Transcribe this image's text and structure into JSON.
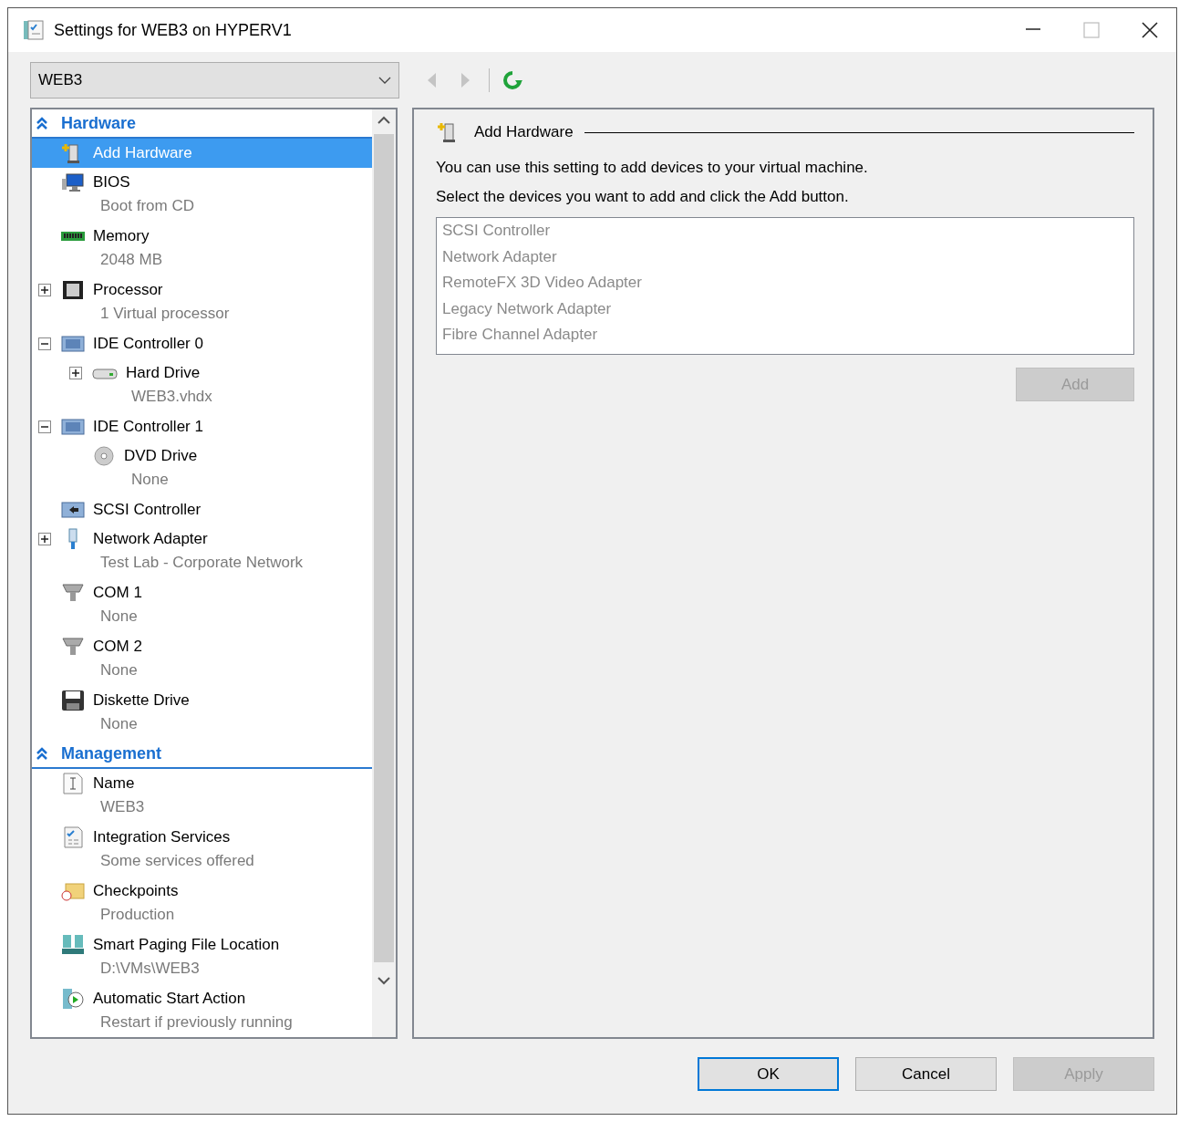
{
  "window": {
    "title": "Settings for WEB3 on HYPERV1",
    "caption_buttons": [
      {
        "kind": "minimize",
        "disabled": false
      },
      {
        "kind": "maximize",
        "disabled": true
      },
      {
        "kind": "close",
        "disabled": false
      }
    ]
  },
  "vm_selector": {
    "value": "WEB3"
  },
  "toolbar": [
    {
      "kind": "back",
      "disabled": true
    },
    {
      "kind": "forward",
      "disabled": true
    },
    {
      "kind": "refresh",
      "disabled": false
    }
  ],
  "sections": [
    {
      "title": "Hardware",
      "expanded": true,
      "items": [
        {
          "kind": "add-hardware",
          "label": "Add Hardware",
          "selected": true
        },
        {
          "kind": "bios",
          "label": "BIOS",
          "detail": "Boot from CD",
          "selected": false
        },
        {
          "kind": "memory",
          "label": "Memory",
          "detail": "2048 MB",
          "selected": false
        },
        {
          "kind": "processor",
          "label": "Processor",
          "detail": "1 Virtual processor",
          "expanded": false,
          "selected": false
        },
        {
          "kind": "controller",
          "label": "IDE Controller 0",
          "expanded": true,
          "selected": false,
          "children": [
            {
              "kind": "hard-drive",
              "label": "Hard Drive",
              "detail": "WEB3.vhdx",
              "expanded": false,
              "selected": false
            }
          ]
        },
        {
          "kind": "controller",
          "label": "IDE Controller 1",
          "expanded": true,
          "selected": false,
          "children": [
            {
              "kind": "dvd",
              "label": "DVD Drive",
              "detail": "None",
              "selected": false
            }
          ]
        },
        {
          "kind": "scsi",
          "label": "SCSI Controller",
          "selected": false
        },
        {
          "kind": "network",
          "label": "Network Adapter",
          "detail": "Test Lab - Corporate Network",
          "expanded": false,
          "selected": false
        },
        {
          "kind": "com",
          "label": "COM 1",
          "detail": "None",
          "selected": false
        },
        {
          "kind": "com",
          "label": "COM 2",
          "detail": "None",
          "selected": false
        },
        {
          "kind": "diskette",
          "label": "Diskette Drive",
          "detail": "None",
          "selected": false
        }
      ]
    },
    {
      "title": "Management",
      "expanded": true,
      "items": [
        {
          "kind": "name",
          "label": "Name",
          "detail": "WEB3",
          "selected": false
        },
        {
          "kind": "integration",
          "label": "Integration Services",
          "detail": "Some services offered",
          "selected": false
        },
        {
          "kind": "checkpoints",
          "label": "Checkpoints",
          "detail": "Production",
          "selected": false
        },
        {
          "kind": "paging",
          "label": "Smart Paging File Location",
          "detail": "D:\\VMs\\WEB3",
          "selected": false
        },
        {
          "kind": "autostart",
          "label": "Automatic Start Action",
          "detail": "Restart if previously running",
          "selected": false
        }
      ]
    }
  ],
  "detail": {
    "title": "Add Hardware",
    "intro": "You can use this setting to add devices to your virtual machine.",
    "instruction": "Select the devices you want to add and click the Add button.",
    "device_list": {
      "disabled": true,
      "items": [
        "SCSI Controller",
        "Network Adapter",
        "RemoteFX 3D Video Adapter",
        "Legacy Network Adapter",
        "Fibre Channel Adapter"
      ]
    },
    "add_button": {
      "label": "Add",
      "disabled": true
    }
  },
  "buttons": [
    {
      "label": "OK",
      "default": true,
      "disabled": false
    },
    {
      "label": "Cancel",
      "default": false,
      "disabled": false
    },
    {
      "label": "Apply",
      "default": false,
      "disabled": true
    }
  ]
}
